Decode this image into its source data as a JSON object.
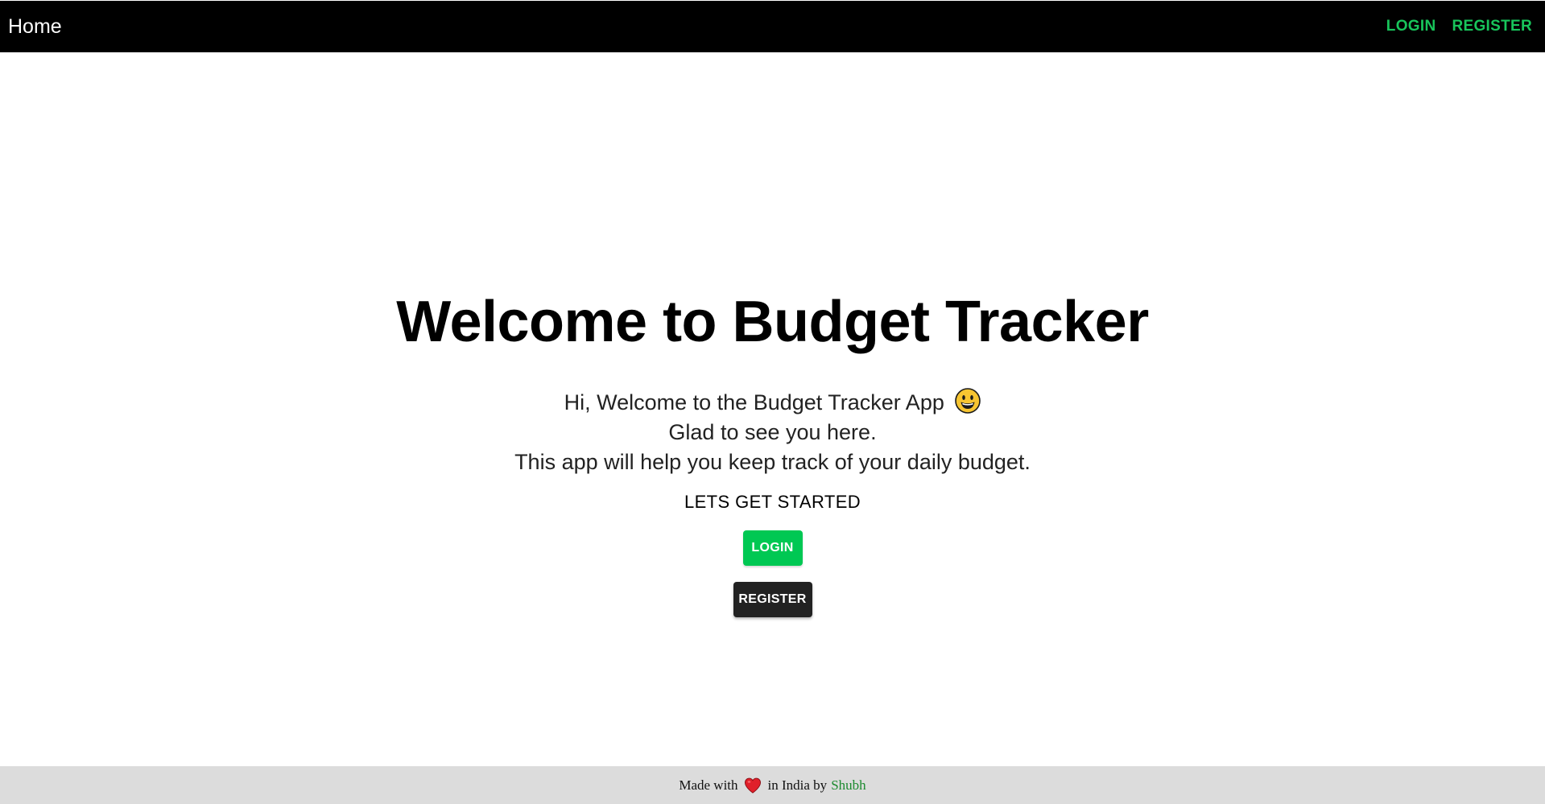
{
  "navbar": {
    "brand": "Home",
    "links": [
      {
        "label": "LOGIN"
      },
      {
        "label": "REGISTER"
      }
    ]
  },
  "hero": {
    "title": "Welcome to Budget Tracker",
    "intro_lines": [
      "Hi, Welcome to the Budget Tracker App",
      "Glad to see you here.",
      "This app will help you keep track of your daily budget."
    ],
    "cta_heading": "LETS GET STARTED",
    "login_button": "LOGIN",
    "register_button": "REGISTER"
  },
  "footer": {
    "prefix": "Made with",
    "middle": "in India by",
    "author": "Shubh"
  },
  "icons": {
    "intro_emoji": "grinning-face-icon",
    "footer_heart": "heart-icon"
  },
  "colors": {
    "navbar_bg": "#000000",
    "nav_link": "#18c55b",
    "login_button": "#00c853",
    "register_button": "#222222",
    "footer_bg": "#dcdcdc",
    "author_link": "#1b8a2e",
    "heart": "#e0202a"
  }
}
